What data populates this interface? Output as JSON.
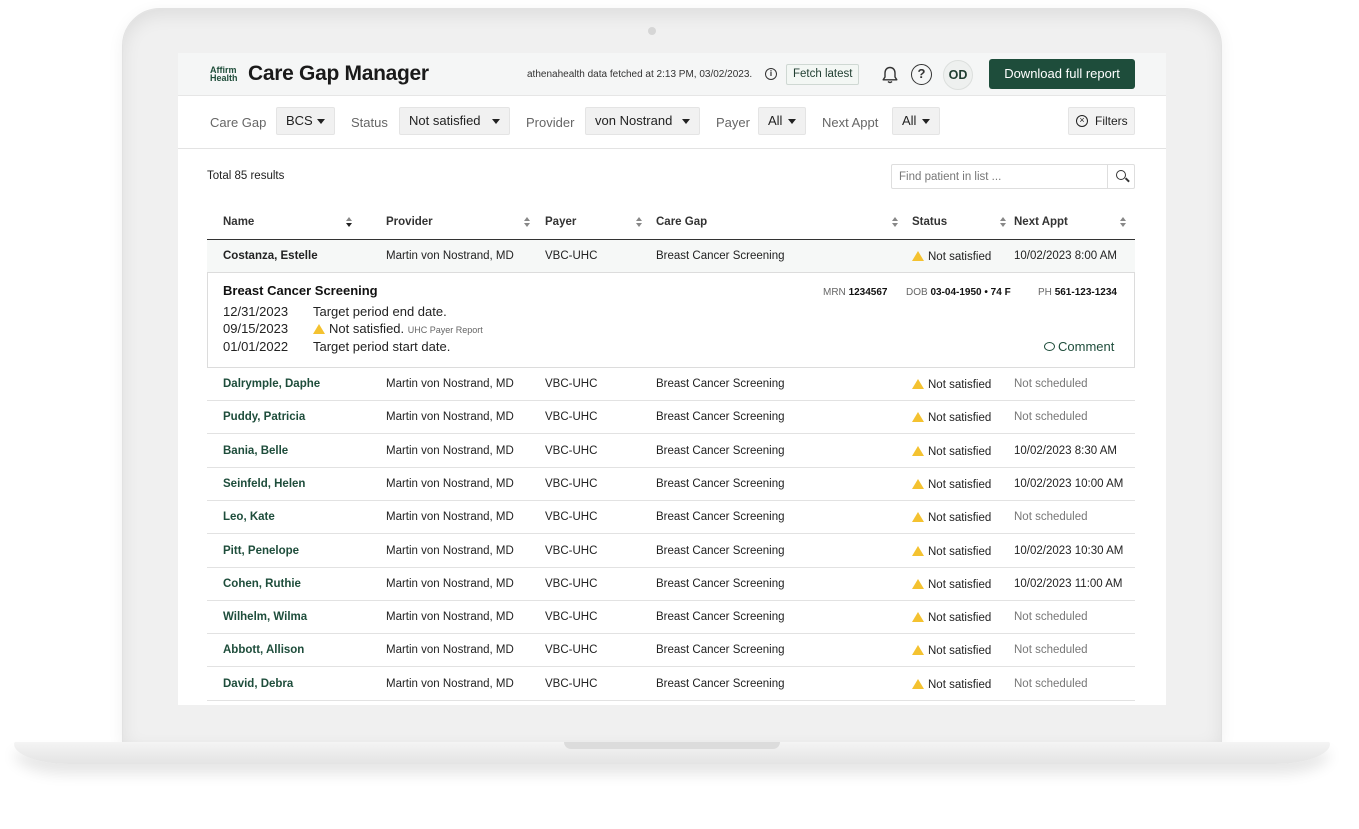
{
  "header": {
    "logo_line1": "Affirm",
    "logo_line2": "Health",
    "app_title": "Care Gap Manager",
    "fetch_info": "athenahealth data fetched at 2:13 PM, 03/02/2023.",
    "fetch_button": "Fetch latest",
    "help_glyph": "?",
    "avatar_initials": "OD",
    "download_button": "Download full report"
  },
  "filters": {
    "care_gap_label": "Care Gap",
    "care_gap_value": "BCS",
    "status_label": "Status",
    "status_value": "Not satisfied",
    "provider_label": "Provider",
    "provider_value": "von Nostrand",
    "payer_label": "Payer",
    "payer_value": "All",
    "next_appt_label": "Next Appt",
    "next_appt_value": "All",
    "filters_button": "Filters"
  },
  "results": {
    "total": "Total 85 results",
    "search_placeholder": "Find patient in list ..."
  },
  "table": {
    "columns": [
      "Name",
      "Provider",
      "Payer",
      "Care Gap",
      "Status",
      "Next Appt"
    ],
    "selected_row": {
      "name": "Costanza, Estelle",
      "provider": "Martin von Nostrand, MD",
      "payer": "VBC-UHC",
      "care_gap": "Breast Cancer Screening",
      "status": "Not satisfied",
      "next_appt": "10/02/2023 8:00 AM"
    },
    "rows": [
      {
        "name": "Dalrymple, Daphe",
        "provider": "Martin von Nostrand, MD",
        "payer": "VBC-UHC",
        "care_gap": "Breast Cancer Screening",
        "status": "Not satisfied",
        "next_appt": "Not scheduled"
      },
      {
        "name": "Puddy, Patricia",
        "provider": "Martin von Nostrand, MD",
        "payer": "VBC-UHC",
        "care_gap": "Breast Cancer Screening",
        "status": "Not satisfied",
        "next_appt": "Not scheduled"
      },
      {
        "name": "Bania, Belle",
        "provider": "Martin von Nostrand, MD",
        "payer": "VBC-UHC",
        "care_gap": "Breast Cancer Screening",
        "status": "Not satisfied",
        "next_appt": "10/02/2023 8:30 AM"
      },
      {
        "name": "Seinfeld, Helen",
        "provider": "Martin von Nostrand, MD",
        "payer": "VBC-UHC",
        "care_gap": "Breast Cancer Screening",
        "status": "Not satisfied",
        "next_appt": "10/02/2023 10:00 AM"
      },
      {
        "name": "Leo, Kate",
        "provider": "Martin von Nostrand, MD",
        "payer": "VBC-UHC",
        "care_gap": "Breast Cancer Screening",
        "status": "Not satisfied",
        "next_appt": "Not scheduled"
      },
      {
        "name": "Pitt, Penelope",
        "provider": "Martin von Nostrand, MD",
        "payer": "VBC-UHC",
        "care_gap": "Breast Cancer Screening",
        "status": "Not satisfied",
        "next_appt": "10/02/2023 10:30 AM"
      },
      {
        "name": "Cohen, Ruthie",
        "provider": "Martin von Nostrand, MD",
        "payer": "VBC-UHC",
        "care_gap": "Breast Cancer Screening",
        "status": "Not satisfied",
        "next_appt": "10/02/2023 11:00 AM"
      },
      {
        "name": "Wilhelm, Wilma",
        "provider": "Martin von Nostrand, MD",
        "payer": "VBC-UHC",
        "care_gap": "Breast Cancer Screening",
        "status": "Not satisfied",
        "next_appt": "Not scheduled"
      },
      {
        "name": "Abbott, Allison",
        "provider": "Martin von Nostrand, MD",
        "payer": "VBC-UHC",
        "care_gap": "Breast Cancer Screening",
        "status": "Not satisfied",
        "next_appt": "Not scheduled"
      },
      {
        "name": "David, Debra",
        "provider": "Martin von Nostrand, MD",
        "payer": "VBC-UHC",
        "care_gap": "Breast Cancer Screening",
        "status": "Not satisfied",
        "next_appt": "Not scheduled"
      }
    ]
  },
  "detail": {
    "title": "Breast Cancer Screening",
    "mrn_label": "MRN",
    "mrn": "1234567",
    "dob_label": "DOB",
    "dob": "03-04-1950 • 74 F",
    "ph_label": "PH",
    "ph": "561-123-1234",
    "events": [
      {
        "date": "12/31/2023",
        "text": "Target period end date.",
        "note": ""
      },
      {
        "date": "09/15/2023",
        "text": "Not satisfied.",
        "note": "UHC Payer Report"
      },
      {
        "date": "01/01/2022",
        "text": "Target period start date.",
        "note": ""
      }
    ],
    "comment_button": "Comment"
  },
  "colors": {
    "brand_green": "#1e4d3b",
    "warning_yellow": "#f4c230"
  },
  "icons": [
    "info-icon",
    "bell-icon",
    "help-icon",
    "close-circle-icon",
    "search-icon",
    "sort-icon",
    "warning-icon",
    "comment-icon",
    "caret-down-icon"
  ]
}
